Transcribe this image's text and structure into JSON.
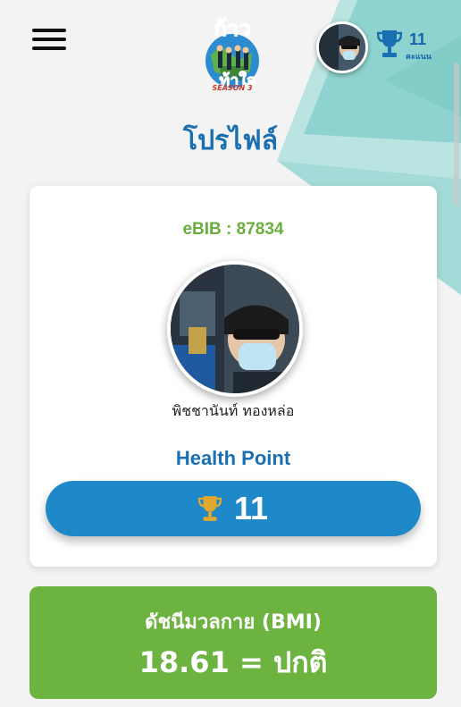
{
  "header": {
    "logo": {
      "title": "ก้าว ท้าใจ",
      "season": "SEASON 3"
    },
    "score": {
      "value": "11",
      "label": "คะแนน"
    }
  },
  "page_title": "โปรไฟล์",
  "profile": {
    "ebib": "eBIB : 87834",
    "name": "พิชชานันท์ ทองหล่อ",
    "health_point_label": "Health Point",
    "health_point_value": "11"
  },
  "bmi": {
    "title": "ดัชนีมวลกาย (BMI)",
    "value": "18.61 = ปกติ"
  },
  "colors": {
    "primary_blue": "#1f88c8",
    "title_blue": "#1a6fb0",
    "green": "#6db340",
    "teal_bg": "#8ed3cf",
    "trophy_gold": "#e0a82e"
  },
  "icons": [
    "menu-icon",
    "trophy-icon"
  ]
}
